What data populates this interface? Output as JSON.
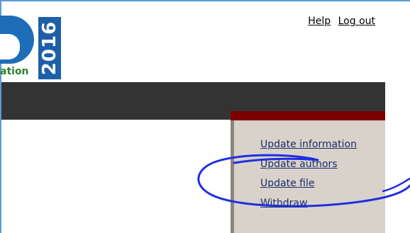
{
  "logo": {
    "tagline": "ation",
    "year": "2016",
    "letter_color": "#1d6db8",
    "year_bg_color": "#1d5fa8",
    "tagline_color": "#2e7d32"
  },
  "header": {
    "links": [
      {
        "label": "Help"
      },
      {
        "label": "Log out"
      }
    ]
  },
  "nav_bar": {
    "color": "#333333"
  },
  "side_menu": {
    "accent_color": "#7b0000",
    "background_color": "#d9d2cb",
    "items": [
      {
        "label": "Update information"
      },
      {
        "label": "Update authors"
      },
      {
        "label": "Update file"
      },
      {
        "label": "Withdraw"
      }
    ]
  },
  "annotation": {
    "shape": "hand-drawn ellipse",
    "color": "#1f2fe0"
  }
}
